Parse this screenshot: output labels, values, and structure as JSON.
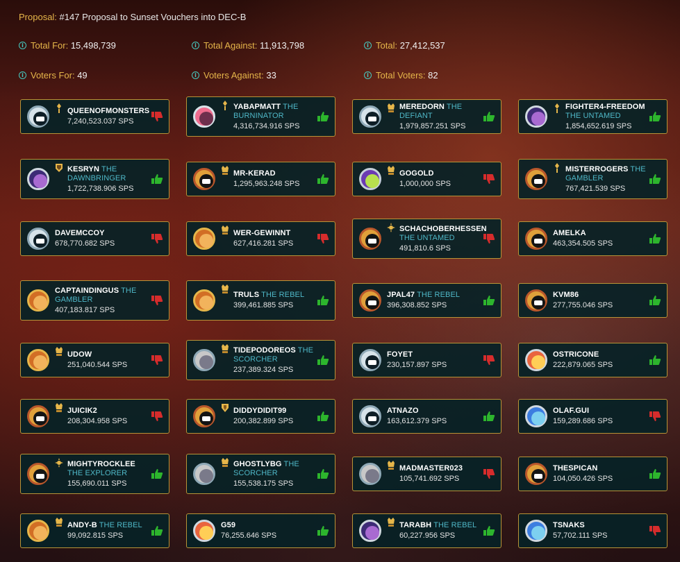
{
  "proposal": {
    "label": "Proposal:",
    "text": "#147 Proposal to Sunset Vouchers into DEC-B"
  },
  "stats": {
    "total_for": {
      "label": "Total For:",
      "value": "15,498,739"
    },
    "total_against": {
      "label": "Total Against:",
      "value": "11,913,798"
    },
    "total": {
      "label": "Total:",
      "value": "27,412,537"
    },
    "voters_for": {
      "label": "Voters For:",
      "value": "49"
    },
    "voters_against": {
      "label": "Voters Against:",
      "value": "33"
    },
    "total_voters": {
      "label": "Total Voters:",
      "value": "82"
    }
  },
  "colors": {
    "for": "#2db52d",
    "against": "#d62c2c",
    "accent": "#e6b64a",
    "title": "#4fb8c8",
    "card_border": "#b89437"
  },
  "voters": [
    {
      "name": "QUEENOFMONSTERS",
      "title": "",
      "sps": "7,240,523.037 SPS",
      "vote": "against",
      "avatar": "silver",
      "rank": "gold-rank-icon"
    },
    {
      "name": "YABAPMATT",
      "title": " THE BURNINATOR",
      "sps": "4,316,734.916 SPS",
      "vote": "for",
      "avatar": "pink",
      "rank": "gold-rank-icon"
    },
    {
      "name": "MEREDORN",
      "title": " THE DEFIANT",
      "sps": "1,979,857.251 SPS",
      "vote": "for",
      "avatar": "silver",
      "rank": "champion-rank-icon"
    },
    {
      "name": "FIGHTER4-FREEDOM",
      "title": " THE UNTAMED",
      "sps": "1,854,652.619 SPS",
      "vote": "for",
      "avatar": "lavender",
      "rank": "gold-rank-icon"
    },
    {
      "name": "KESRYN",
      "title": " THE DAWNBRINGER",
      "sps": "1,722,738.906 SPS",
      "vote": "for",
      "avatar": "lavender",
      "rank": "diamond-rank-icon"
    },
    {
      "name": "MR-KERAD",
      "title": "",
      "sps": "1,295,963.248 SPS",
      "vote": "for",
      "avatar": "gold",
      "rank": "champion-rank-icon"
    },
    {
      "name": "GOGOLD",
      "title": "",
      "sps": "1,000,000 SPS",
      "vote": "against",
      "avatar": "purple",
      "rank": "champion-rank-icon"
    },
    {
      "name": "MISTERROGERS",
      "title": " THE GAMBLER",
      "sps": "767,421.539 SPS",
      "vote": "for",
      "avatar": "gold",
      "rank": "gold-rank-icon"
    },
    {
      "name": "DAVEMCCOY",
      "title": "",
      "sps": "678,770.682 SPS",
      "vote": "against",
      "avatar": "silver",
      "rank": ""
    },
    {
      "name": "WER-GEWINNT",
      "title": "",
      "sps": "627,416.281 SPS",
      "vote": "against",
      "avatar": "orange",
      "rank": "champion-rank-icon"
    },
    {
      "name": "SCHACHOBERHESSEN",
      "title": " THE UNTAMED",
      "sps": "491,810.6 SPS",
      "vote": "against",
      "avatar": "gold",
      "rank": "sun-rank-icon"
    },
    {
      "name": "AMELKA",
      "title": "",
      "sps": "463,354.505 SPS",
      "vote": "for",
      "avatar": "gold",
      "rank": ""
    },
    {
      "name": "CAPTAINDINGUS",
      "title": " THE GAMBLER",
      "sps": "407,183.817 SPS",
      "vote": "against",
      "avatar": "orange",
      "rank": ""
    },
    {
      "name": "TRULS",
      "title": " THE REBEL",
      "sps": "399,461.885 SPS",
      "vote": "for",
      "avatar": "orange",
      "rank": "champion-rank-icon"
    },
    {
      "name": "JPAL47",
      "title": " THE REBEL",
      "sps": "396,308.852 SPS",
      "vote": "for",
      "avatar": "gold",
      "rank": ""
    },
    {
      "name": "KVM86",
      "title": "",
      "sps": "277,755.046 SPS",
      "vote": "for",
      "avatar": "gold",
      "rank": ""
    },
    {
      "name": "UDOW",
      "title": "",
      "sps": "251,040.544 SPS",
      "vote": "against",
      "avatar": "orange",
      "rank": "champion-rank-icon"
    },
    {
      "name": "TIDEPODOREOS",
      "title": " THE SCORCHER",
      "sps": "237,389.324 SPS",
      "vote": "for",
      "avatar": "grey",
      "rank": "champion-rank-icon"
    },
    {
      "name": "FOYET",
      "title": "",
      "sps": "230,157.897 SPS",
      "vote": "against",
      "avatar": "silver",
      "rank": ""
    },
    {
      "name": "OSTRICONE",
      "title": "",
      "sps": "222,879.065 SPS",
      "vote": "for",
      "avatar": "red",
      "rank": ""
    },
    {
      "name": "JUICIK2",
      "title": "",
      "sps": "208,304.958 SPS",
      "vote": "against",
      "avatar": "gold",
      "rank": "champion-rank-icon"
    },
    {
      "name": "DIDDYDIDIT99",
      "title": "",
      "sps": "200,382.899 SPS",
      "vote": "for",
      "avatar": "gold",
      "rank": "shield-rank-icon"
    },
    {
      "name": "ATNAZO",
      "title": "",
      "sps": "163,612.379 SPS",
      "vote": "for",
      "avatar": "silver",
      "rank": ""
    },
    {
      "name": "OLAF.GUI",
      "title": "",
      "sps": "159,289.686 SPS",
      "vote": "against",
      "avatar": "blue",
      "rank": ""
    },
    {
      "name": "MIGHTYROCKLEE",
      "title": " THE EXPLORER",
      "sps": "155,690.011 SPS",
      "vote": "for",
      "avatar": "gold",
      "rank": "sun-rank-icon"
    },
    {
      "name": "GHOSTLYBG",
      "title": " THE SCORCHER",
      "sps": "155,538.175 SPS",
      "vote": "for",
      "avatar": "grey",
      "rank": "champion-rank-icon"
    },
    {
      "name": "MADMASTER023",
      "title": "",
      "sps": "105,741.692 SPS",
      "vote": "against",
      "avatar": "grey",
      "rank": "champion-rank-icon"
    },
    {
      "name": "THESPICAN",
      "title": "",
      "sps": "104,050.426 SPS",
      "vote": "for",
      "avatar": "gold",
      "rank": ""
    },
    {
      "name": "ANDY-B",
      "title": " THE REBEL",
      "sps": "99,092.815 SPS",
      "vote": "for",
      "avatar": "orange",
      "rank": "champion-rank-icon"
    },
    {
      "name": "G59",
      "title": "",
      "sps": "76,255.646 SPS",
      "vote": "for",
      "avatar": "red",
      "rank": ""
    },
    {
      "name": "TARABH",
      "title": " THE REBEL",
      "sps": "60,227.956 SPS",
      "vote": "for",
      "avatar": "lavender",
      "rank": "champion-rank-icon"
    },
    {
      "name": "TSNAKS",
      "title": "",
      "sps": "57,702.111 SPS",
      "vote": "against",
      "avatar": "blue",
      "rank": ""
    }
  ]
}
